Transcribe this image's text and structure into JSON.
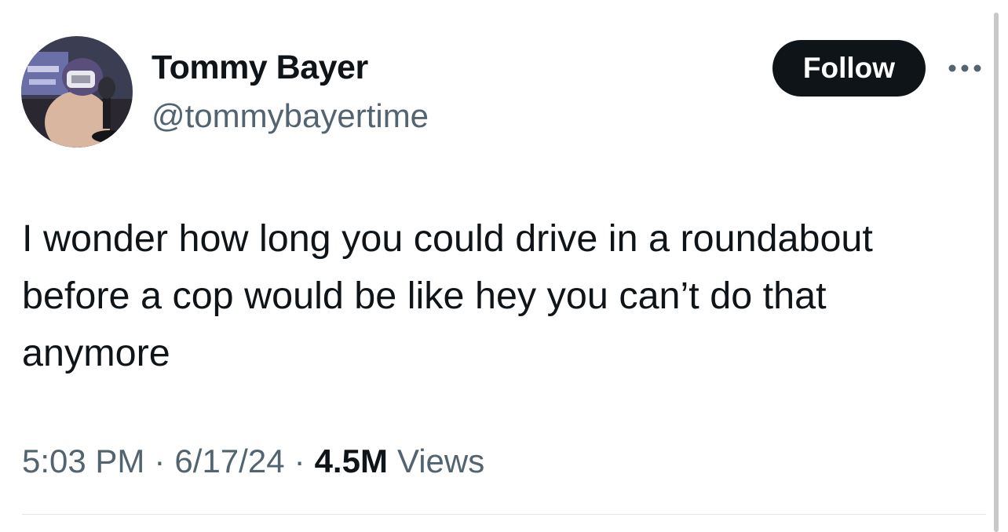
{
  "author": {
    "display_name": "Tommy Bayer",
    "handle": "@tommybayertime",
    "avatar_icon": "profile-photo"
  },
  "actions": {
    "follow_label": "Follow",
    "more_icon": "ellipsis-icon"
  },
  "tweet": {
    "text": "I wonder how long you could drive in a roundabout\nbefore a cop would be like hey you can’t do that\nanymore"
  },
  "meta": {
    "time": "5:03 PM",
    "separator": "·",
    "date": "6/17/24",
    "views_count": "4.5M",
    "views_label": "Views"
  },
  "colors": {
    "text_primary": "#0f1419",
    "text_secondary": "#536471",
    "button_bg": "#0f1419",
    "button_text": "#ffffff",
    "divider": "#e3e7ea"
  }
}
